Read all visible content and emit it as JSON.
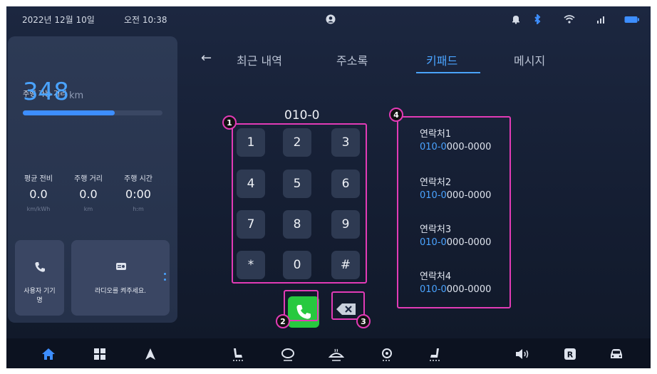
{
  "status_bar": {
    "date": "2022년 12월 10일",
    "time": "오전 10:38",
    "icons": [
      "profile-icon",
      "bell-icon",
      "bluetooth-icon",
      "wifi-icon",
      "signal-icon",
      "battery-icon"
    ]
  },
  "left_panel": {
    "range_label": "주행 가능 거리",
    "range_value": "348",
    "range_unit": "km",
    "range_progress_fraction": 0.66,
    "stats": [
      {
        "label": "평균 전비",
        "value": "0.0",
        "unit": "km/kWh"
      },
      {
        "label": "주행 거리",
        "value": "0.0",
        "unit": "km"
      },
      {
        "label": "주행 시간",
        "value": "0:00",
        "unit": "h:m"
      }
    ],
    "cards": [
      {
        "icon": "phone-icon",
        "caption_line1": "사용자 기기",
        "caption_line2": "명"
      },
      {
        "icon": "radio-icon",
        "caption": "라디오를 켜주세요."
      }
    ]
  },
  "tabs": [
    {
      "label": "최근 내역",
      "active": false
    },
    {
      "label": "주소록",
      "active": false
    },
    {
      "label": "키패드",
      "active": true
    },
    {
      "label": "메시지",
      "active": false
    }
  ],
  "keypad": {
    "dialed": "010-0",
    "keys": [
      "1",
      "2",
      "3",
      "4",
      "5",
      "6",
      "7",
      "8",
      "9",
      "*",
      "0",
      "#"
    ]
  },
  "contacts": [
    {
      "name": "연락처1",
      "number_highlight": "010-0",
      "number_rest": "000-0000"
    },
    {
      "name": "연락처2",
      "number_highlight": "010-0",
      "number_rest": "000-0000"
    },
    {
      "name": "연락처3",
      "number_highlight": "010-0",
      "number_rest": "000-0000"
    },
    {
      "name": "연락처4",
      "number_highlight": "010-0",
      "number_rest": "000-0000"
    }
  ],
  "badges": [
    "1",
    "2",
    "3",
    "4"
  ],
  "colors": {
    "accent": "#4aa3ff",
    "highlight": "#e23bb6",
    "call": "#27c93f"
  }
}
